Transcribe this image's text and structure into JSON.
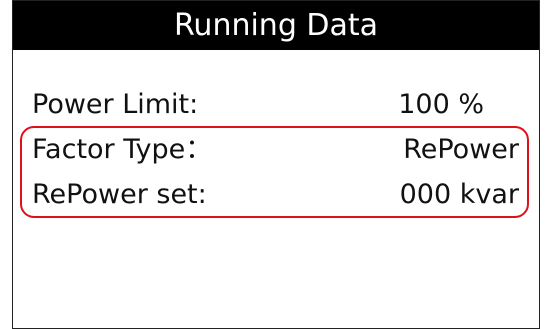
{
  "header": {
    "title": "Running Data"
  },
  "rows": [
    {
      "label": "Power Limit:",
      "value": "100 %"
    },
    {
      "label": "Factor Type：",
      "value": "RePower"
    },
    {
      "label": "RePower set:",
      "value": "000 kvar"
    }
  ],
  "colors": {
    "titlebar_background": "#000000",
    "titlebar_text": "#ffffff",
    "highlight_border": "#e0101a"
  }
}
